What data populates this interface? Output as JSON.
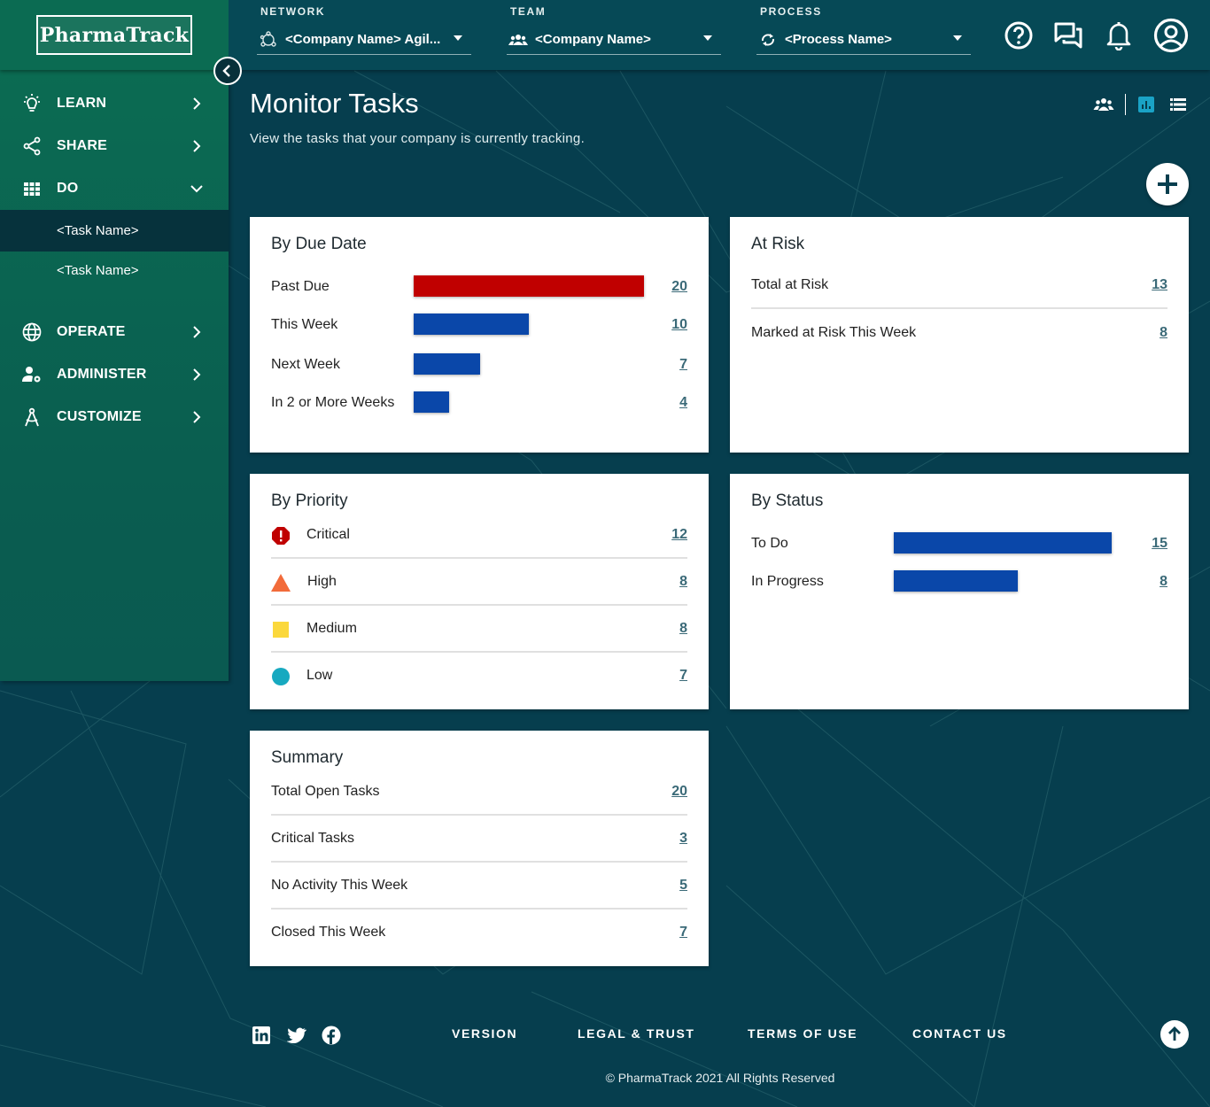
{
  "brand": {
    "name": "PharmaTrack"
  },
  "topbar": {
    "network": {
      "label": "NETWORK",
      "value": "<Company Name> Agil..."
    },
    "team": {
      "label": "TEAM",
      "value": "<Company Name>"
    },
    "process": {
      "label": "PROCESS",
      "value": "<Process Name>"
    },
    "icons": [
      "help-icon",
      "chat-icon",
      "bell-icon",
      "account-icon"
    ]
  },
  "sidebar": {
    "items": [
      {
        "label": "LEARN",
        "icon": "lightbulb-icon"
      },
      {
        "label": "SHARE",
        "icon": "share-icon"
      },
      {
        "label": "DO",
        "icon": "grid-icon",
        "expanded": true
      },
      {
        "label": "OPERATE",
        "icon": "globe-icon"
      },
      {
        "label": "ADMINISTER",
        "icon": "user-gear-icon"
      },
      {
        "label": "CUSTOMIZE",
        "icon": "compass-icon"
      }
    ],
    "subitems": [
      {
        "label": "<Task Name>",
        "active": true
      },
      {
        "label": "<Task Name>",
        "active": false
      }
    ]
  },
  "page": {
    "title": "Monitor Tasks",
    "subtitle": "View the tasks that your company is currently tracking."
  },
  "cards": {
    "due": {
      "title": "By Due Date",
      "rows": [
        {
          "label": "Past Due",
          "value": "20",
          "color": "#c00000"
        },
        {
          "label": "This Week",
          "value": "10",
          "color": "#0a47a9"
        },
        {
          "label": "Next Week",
          "value": "7",
          "color": "#0a47a9"
        },
        {
          "label": "In 2 or More Weeks",
          "value": "4",
          "color": "#0a47a9"
        }
      ]
    },
    "risk": {
      "title": "At Risk",
      "rows": [
        {
          "label": "Total at Risk",
          "value": "13"
        },
        {
          "label": "Marked at Risk This Week",
          "value": "8"
        }
      ]
    },
    "priority": {
      "title": "By Priority",
      "rows": [
        {
          "label": "Critical",
          "value": "12",
          "icon": "critical-octagon-icon",
          "color": "#c00000"
        },
        {
          "label": "High",
          "value": "8",
          "icon": "high-triangle-icon",
          "color": "#f26b3a"
        },
        {
          "label": "Medium",
          "value": "8",
          "icon": "medium-square-icon",
          "color": "#fbd83c"
        },
        {
          "label": "Low",
          "value": "7",
          "icon": "low-circle-icon",
          "color": "#17a9c0"
        }
      ]
    },
    "status": {
      "title": "By Status",
      "rows": [
        {
          "label": "To Do",
          "value": "15",
          "color": "#0a47a9"
        },
        {
          "label": "In Progress",
          "value": "8",
          "color": "#0a47a9"
        }
      ]
    },
    "summary": {
      "title": "Summary",
      "rows": [
        {
          "label": "Total Open Tasks",
          "value": "20"
        },
        {
          "label": "Critical Tasks",
          "value": "3"
        },
        {
          "label": "No Activity This Week",
          "value": "5"
        },
        {
          "label": "Closed This Week",
          "value": "7"
        }
      ]
    }
  },
  "footer": {
    "social": [
      "linkedin-icon",
      "twitter-icon",
      "facebook-icon"
    ],
    "links": [
      "VERSION",
      "LEGAL & TRUST",
      "TERMS OF USE",
      "CONTACT US"
    ],
    "copyright": "© PharmaTrack 2021 All Rights Reserved"
  },
  "colors": {
    "background": "#063e4e",
    "sidebar": "#0b6b52",
    "accent_blue": "#0a47a9",
    "past_due_red": "#c00000",
    "link": "#3b6a78"
  }
}
